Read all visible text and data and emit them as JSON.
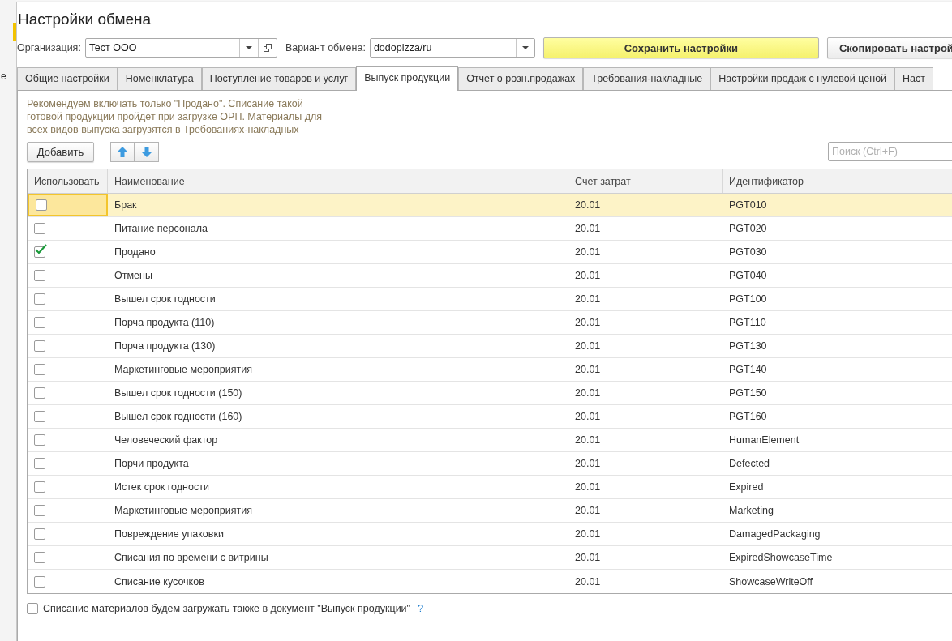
{
  "background_window": {
    "fragment": "е"
  },
  "window": {
    "title": "Настройки обмена"
  },
  "header": {
    "organization": {
      "label": "Организация:",
      "value": "Тест ООО"
    },
    "exchange_variant": {
      "label": "Вариант обмена:",
      "value": "dodopizza/ru"
    },
    "buttons": [
      {
        "label": "Сохранить настройки",
        "kind": "primary"
      },
      {
        "label": "Скопировать настрой",
        "kind": "normal"
      }
    ]
  },
  "tabs": [
    {
      "label": "Общие настройки",
      "selected": false
    },
    {
      "label": "Номенклатура",
      "selected": false
    },
    {
      "label": "Поступление товаров и услуг",
      "selected": false
    },
    {
      "label": "Выпуск продукции",
      "selected": true
    },
    {
      "label": "Отчет о розн.продажах",
      "selected": false
    },
    {
      "label": "Требования-накладные",
      "selected": false
    },
    {
      "label": "Настройки продаж с нулевой ценой",
      "selected": false
    },
    {
      "label": "Наст",
      "selected": false
    }
  ],
  "hint": "Рекомендуем включать только \"Продано\". Списание такой готовой продукции пройдет при загрузке ОРП. Материалы для всех видов выпуска загрузятся в Требованиях-накладных",
  "toolbar": {
    "add_button": "Добавить",
    "search": {
      "placeholder": "Поиск (Ctrl+F)"
    }
  },
  "table": {
    "columns": [
      "Использовать",
      "Наименование",
      "Счет затрат",
      "Идентификатор"
    ],
    "rows": [
      {
        "checked": false,
        "selected": true,
        "name": "Брак",
        "account": "20.01",
        "id": "PGT010"
      },
      {
        "checked": false,
        "selected": false,
        "name": "Питание персонала",
        "account": "20.01",
        "id": "PGT020"
      },
      {
        "checked": true,
        "selected": false,
        "name": "Продано",
        "account": "20.01",
        "id": "PGT030"
      },
      {
        "checked": false,
        "selected": false,
        "name": "Отмены",
        "account": "20.01",
        "id": "PGT040"
      },
      {
        "checked": false,
        "selected": false,
        "name": "Вышел срок годности",
        "account": "20.01",
        "id": "PGT100"
      },
      {
        "checked": false,
        "selected": false,
        "name": "Порча продукта (110)",
        "account": "20.01",
        "id": "PGT110"
      },
      {
        "checked": false,
        "selected": false,
        "name": "Порча продукта (130)",
        "account": "20.01",
        "id": "PGT130"
      },
      {
        "checked": false,
        "selected": false,
        "name": "Маркетинговые мероприятия",
        "account": "20.01",
        "id": "PGT140"
      },
      {
        "checked": false,
        "selected": false,
        "name": "Вышел срок годности (150)",
        "account": "20.01",
        "id": "PGT150"
      },
      {
        "checked": false,
        "selected": false,
        "name": "Вышел срок годности (160)",
        "account": "20.01",
        "id": "PGT160"
      },
      {
        "checked": false,
        "selected": false,
        "name": "Человеческий фактор",
        "account": "20.01",
        "id": "HumanElement"
      },
      {
        "checked": false,
        "selected": false,
        "name": "Порчи продукта",
        "account": "20.01",
        "id": "Defected"
      },
      {
        "checked": false,
        "selected": false,
        "name": "Истек срок годности",
        "account": "20.01",
        "id": "Expired"
      },
      {
        "checked": false,
        "selected": false,
        "name": "Маркетинговые мероприятия",
        "account": "20.01",
        "id": "Marketing"
      },
      {
        "checked": false,
        "selected": false,
        "name": "Повреждение упаковки",
        "account": "20.01",
        "id": "DamagedPackaging"
      },
      {
        "checked": false,
        "selected": false,
        "name": "Списания по времени с витрины",
        "account": "20.01",
        "id": "ExpiredShowcaseTime"
      },
      {
        "checked": false,
        "selected": false,
        "name": "Списание кусочков",
        "account": "20.01",
        "id": "ShowcaseWriteOff"
      }
    ]
  },
  "footer_option": {
    "label": "Списание материалов будем загружать также в документ \"Выпуск продукции\"",
    "checked": false,
    "help": "?"
  }
}
